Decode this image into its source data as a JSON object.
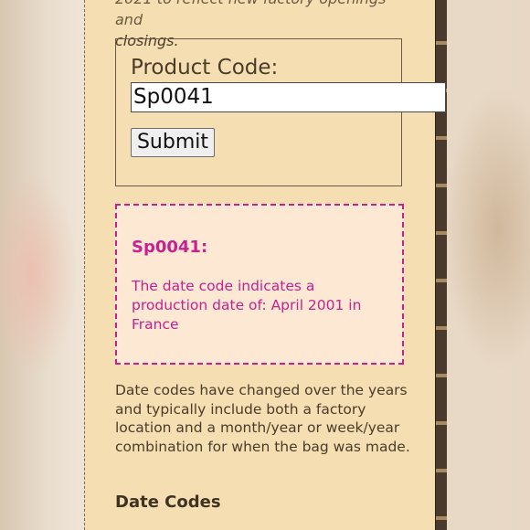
{
  "intro": {
    "line1": "2021 to reflect new factory openings and",
    "line2": "closings."
  },
  "form": {
    "label": "Product Code:",
    "input_value": "Sp0041",
    "submit_label": "Submit"
  },
  "result": {
    "title": "Sp0041:",
    "text": "The date code indicates a production date of: April 2001 in France"
  },
  "info": {
    "paragraph": "Date codes have changed over the years and typically include both a factory location and a month/year or week/year combination for when the bag was made.",
    "section_heading": "Date Codes"
  },
  "colors": {
    "page_bg": "#f5dfb2",
    "result_accent": "#c8218f",
    "result_bg": "#fde8d3",
    "text": "#4a3b2a"
  }
}
